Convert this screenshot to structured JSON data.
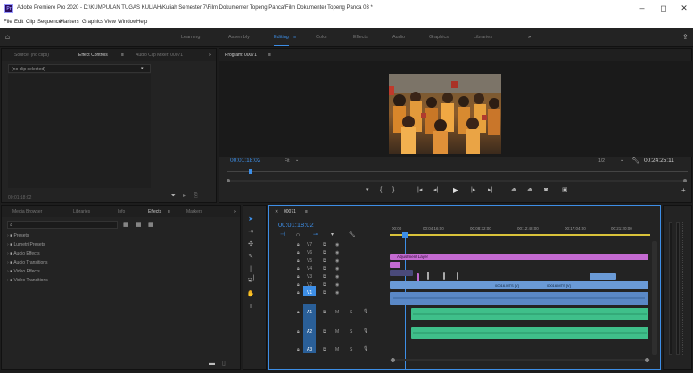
{
  "titlebar": {
    "title": "Adobe Premiere Pro 2020 - D:\\KUMPULAN TUGAS KULIAH\\Kuliah Semester 7\\Film Dokumenter Topeng Panca\\Film Dokumenter Topeng Panca 03 *",
    "app_icon": "Pr",
    "minimize": "–",
    "maximize": "◻",
    "close": "✕"
  },
  "menu": [
    "File",
    "Edit",
    "Clip",
    "Sequence",
    "Markers",
    "Graphics",
    "View",
    "Window",
    "Help"
  ],
  "workspace": {
    "tabs": [
      "Learning",
      "Assembly",
      "Editing",
      "Color",
      "Effects",
      "Audio",
      "Graphics",
      "Libraries"
    ],
    "active": "Editing",
    "editing_label": "Editing"
  },
  "source_panel": {
    "tabs": [
      "Source: (no clips)",
      "Effect Controls",
      "Audio Clip Mixer: 00071"
    ],
    "active": "Effect Controls",
    "no_clip": "(no clip selected)",
    "timecode": "00:01:18:02"
  },
  "program_monitor": {
    "title": "Program: 00071",
    "timecode": "00:01:18:02",
    "fit": "Fit",
    "resolution": "1/2",
    "duration": "00:24:25:11"
  },
  "project_panel": {
    "tabs": [
      "Media Browser",
      "Libraries",
      "Info",
      "Effects",
      "Markers"
    ],
    "active": "Effects",
    "items": [
      "Presets",
      "Lumetri Presets",
      "Audio Effects",
      "Audio Transitions",
      "Video Effects",
      "Video Transitions"
    ]
  },
  "timeline": {
    "tab": "00071",
    "timecode": "00:01:18:02",
    "ruler": [
      "00:00",
      "00:04:16:00",
      "00:08:32:00",
      "00:12:48:00",
      "00:17:04:00",
      "00:21:20:00"
    ],
    "adjustment_layer": "Adjustment Layer",
    "clip_labels": [
      "00016.MTS [V]",
      "00016.MTS [V]"
    ],
    "video_tracks": [
      "V7",
      "V6",
      "V5",
      "V4",
      "V3",
      "V2",
      "V1"
    ],
    "audio_tracks": [
      "A1",
      "A2",
      "A3"
    ]
  },
  "colors": {
    "accent": "#3d8ee6",
    "video_clip": "#6a9ad6",
    "audio_clip": "#3fbf8a",
    "adjustment_clip": "#c46ad1",
    "panel_bg": "#232323"
  }
}
